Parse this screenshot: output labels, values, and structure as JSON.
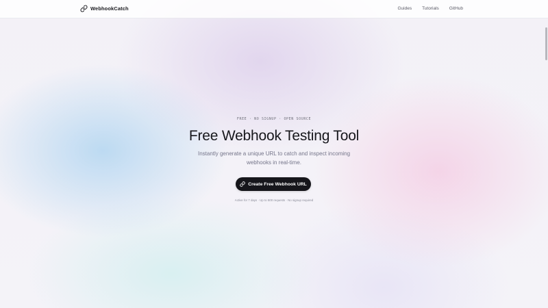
{
  "header": {
    "brand_name": "WebhookCatch",
    "brand_icon": "link-icon",
    "nav": {
      "guides": "Guides",
      "tutorials": "Tutorials",
      "github": "GitHub"
    }
  },
  "hero": {
    "eyebrow": "FREE · NO SIGNUP · OPEN SOURCE",
    "title": "Free Webhook Testing Tool",
    "subtitle": "Instantly generate a unique URL to catch and inspect incoming webhooks in real-time.",
    "cta_label": "Create Free Webhook URL",
    "cta_icon": "link-icon",
    "meta": "Active for 7 days · Up to 500 requests · No signup required"
  },
  "colors": {
    "cta_background": "#16161b",
    "cta_text": "#ffffff",
    "title_text": "#17171c"
  }
}
